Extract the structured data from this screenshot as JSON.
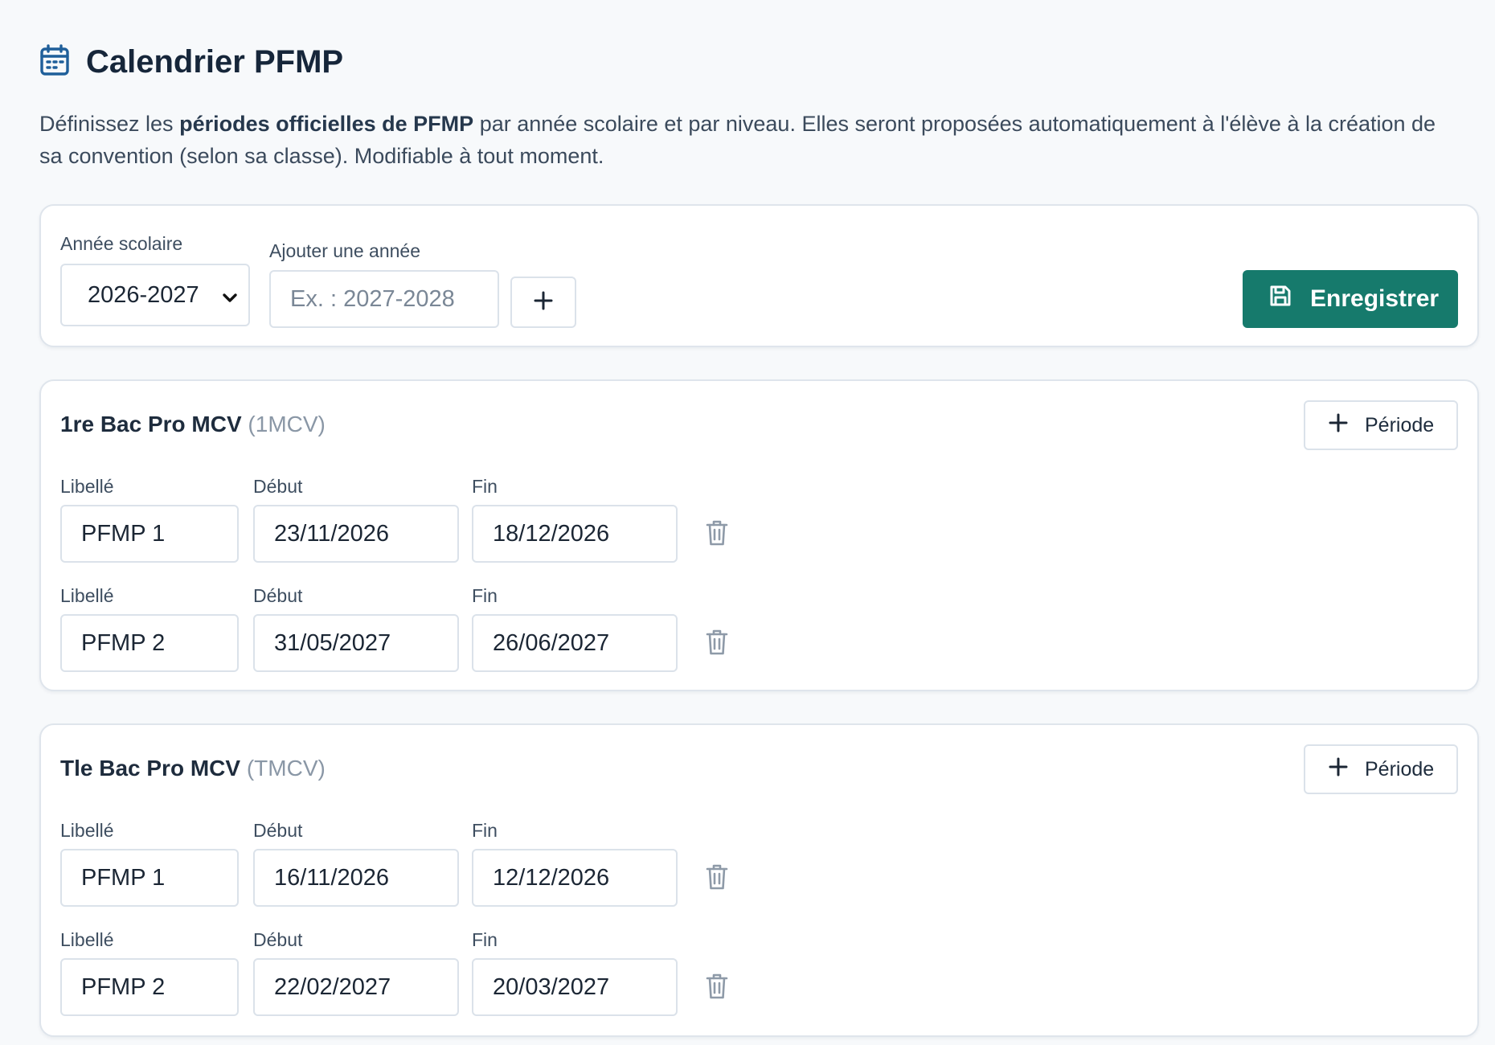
{
  "page": {
    "title": "Calendrier PFMP",
    "intro_part1": "Définissez les ",
    "intro_bold": "périodes officielles de PFMP",
    "intro_part2": " par année scolaire et par niveau. Elles seront proposées automatiquement à l'élève à la création de sa convention (selon sa classe). Modifiable à tout moment."
  },
  "year_card": {
    "year_label": "Année scolaire",
    "year_value": "2026-2027",
    "add_label": "Ajouter une année",
    "add_placeholder": "Ex. : 2027-2028",
    "save_label": "Enregistrer"
  },
  "levels": [
    {
      "name": "1re Bac Pro MCV",
      "code": "(1MCV)",
      "add_period_label": "Période",
      "periods": [
        {
          "label_caption": "Libellé",
          "start_caption": "Début",
          "end_caption": "Fin",
          "label": "PFMP 1",
          "start": "23/11/2026",
          "end": "18/12/2026"
        },
        {
          "label_caption": "Libellé",
          "start_caption": "Début",
          "end_caption": "Fin",
          "label": "PFMP 2",
          "start": "31/05/2027",
          "end": "26/06/2027"
        }
      ]
    },
    {
      "name": "Tle Bac Pro MCV",
      "code": "(TMCV)",
      "add_period_label": "Période",
      "periods": [
        {
          "label_caption": "Libellé",
          "start_caption": "Début",
          "end_caption": "Fin",
          "label": "PFMP 1",
          "start": "16/11/2026",
          "end": "12/12/2026"
        },
        {
          "label_caption": "Libellé",
          "start_caption": "Début",
          "end_caption": "Fin",
          "label": "PFMP 2",
          "start": "22/02/2027",
          "end": "20/03/2027"
        }
      ]
    }
  ],
  "colors": {
    "accent": "#167a6c",
    "title_icon": "#1f5f9a"
  }
}
